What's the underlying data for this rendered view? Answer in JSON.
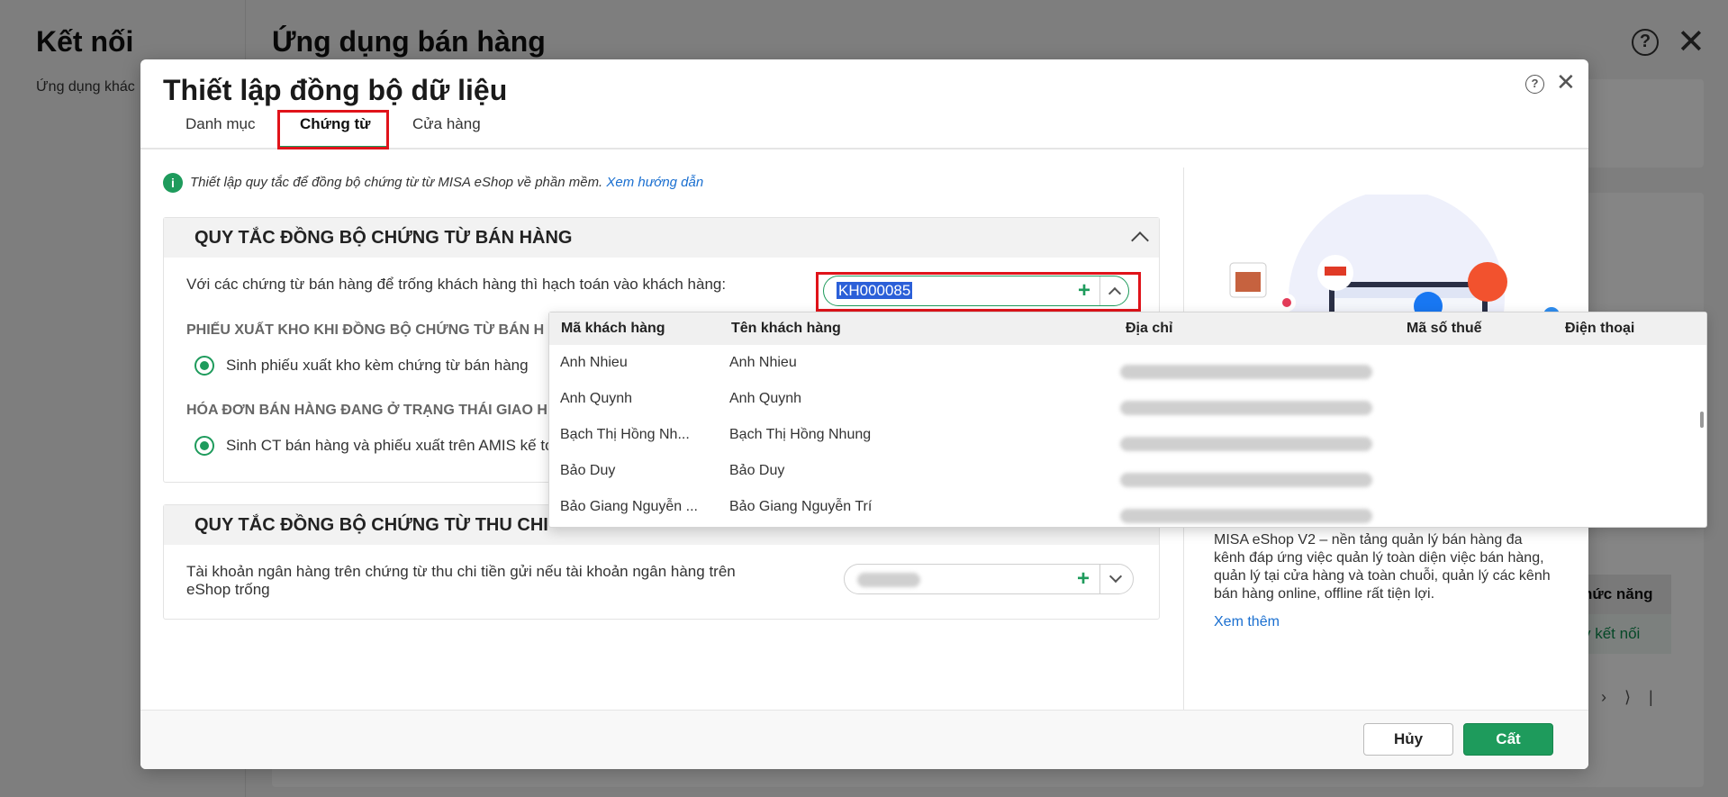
{
  "background": {
    "left_title": "Kết nối",
    "left_subtitle": "Ứng dụng khác",
    "main_title": "Ứng dụng bán hàng",
    "table_header": "hức năng",
    "table_row_link": "y kết nối"
  },
  "modal": {
    "title": "Thiết lập đồng bộ dữ liệu",
    "tabs": [
      {
        "label": "Danh mục"
      },
      {
        "label": "Chứng từ"
      },
      {
        "label": "Cửa hàng"
      }
    ],
    "info_text": "Thiết lập quy tắc để đồng bộ chứng từ từ MISA eShop về phần mềm.",
    "info_link": "Xem hướng dẫn",
    "section1": {
      "title": "QUY TẮC ĐỒNG BỘ CHỨNG TỪ BÁN HÀNG",
      "customer_label": "Với các chứng từ bán hàng để trống khách hàng thì hạch toán vào khách hàng:",
      "customer_value": "KH000085",
      "group1_label": "PHIẾU XUẤT KHO KHI ĐỒNG BỘ CHỨNG TỪ BÁN H",
      "radio1_label": "Sinh phiếu xuất kho kèm chứng từ bán hàng",
      "group2_label": "HÓA ĐƠN BÁN HÀNG ĐANG Ở TRẠNG THÁI GIAO H",
      "radio2_label": "Sinh CT bán hàng và phiếu xuất trên AMIS kế to"
    },
    "section2": {
      "title": "QUY TẮC ĐỒNG BỘ CHỨNG TỪ THU CHI",
      "bank_label_1": "Tài khoản ngân hàng trên chứng từ thu chi tiền gửi nếu tài khoản ngân hàng trên",
      "bank_label_2": "eShop trống"
    },
    "promo": {
      "text": "MISA eShop V2 – nền tảng quản lý bán hàng đa kênh đáp ứng việc quản lý toàn diện việc bán hàng, quản lý tại cửa hàng và toàn chuỗi, quản lý các kênh bán hàng online, offline rất tiện lợi.",
      "link": "Xem thêm"
    },
    "footer": {
      "cancel": "Hủy",
      "save": "Cất"
    }
  },
  "dropdown": {
    "columns": [
      "Mã khách hàng",
      "Tên khách hàng",
      "Địa chỉ",
      "Mã số thuế",
      "Điện thoại"
    ],
    "rows": [
      {
        "code": "Anh Nhieu",
        "name": "Anh Nhieu"
      },
      {
        "code": "Anh Quynh",
        "name": "Anh Quynh"
      },
      {
        "code": "Bạch Thị Hồng Nh...",
        "name": "Bạch Thị Hồng Nhung"
      },
      {
        "code": "Bảo Duy",
        "name": "Bảo Duy"
      },
      {
        "code": "Bảo Giang Nguyễn ...",
        "name": "Bảo Giang Nguyễn Trí"
      }
    ]
  },
  "icons": {
    "info": "info-icon",
    "help": "help-icon",
    "close": "close-icon",
    "add": "plus-icon",
    "expand": "chevron-down-icon",
    "collapse": "chevron-up-icon"
  },
  "colors": {
    "accent": "#1e9b5c",
    "highlight": "#e0131a",
    "link": "#1a6fd0"
  }
}
